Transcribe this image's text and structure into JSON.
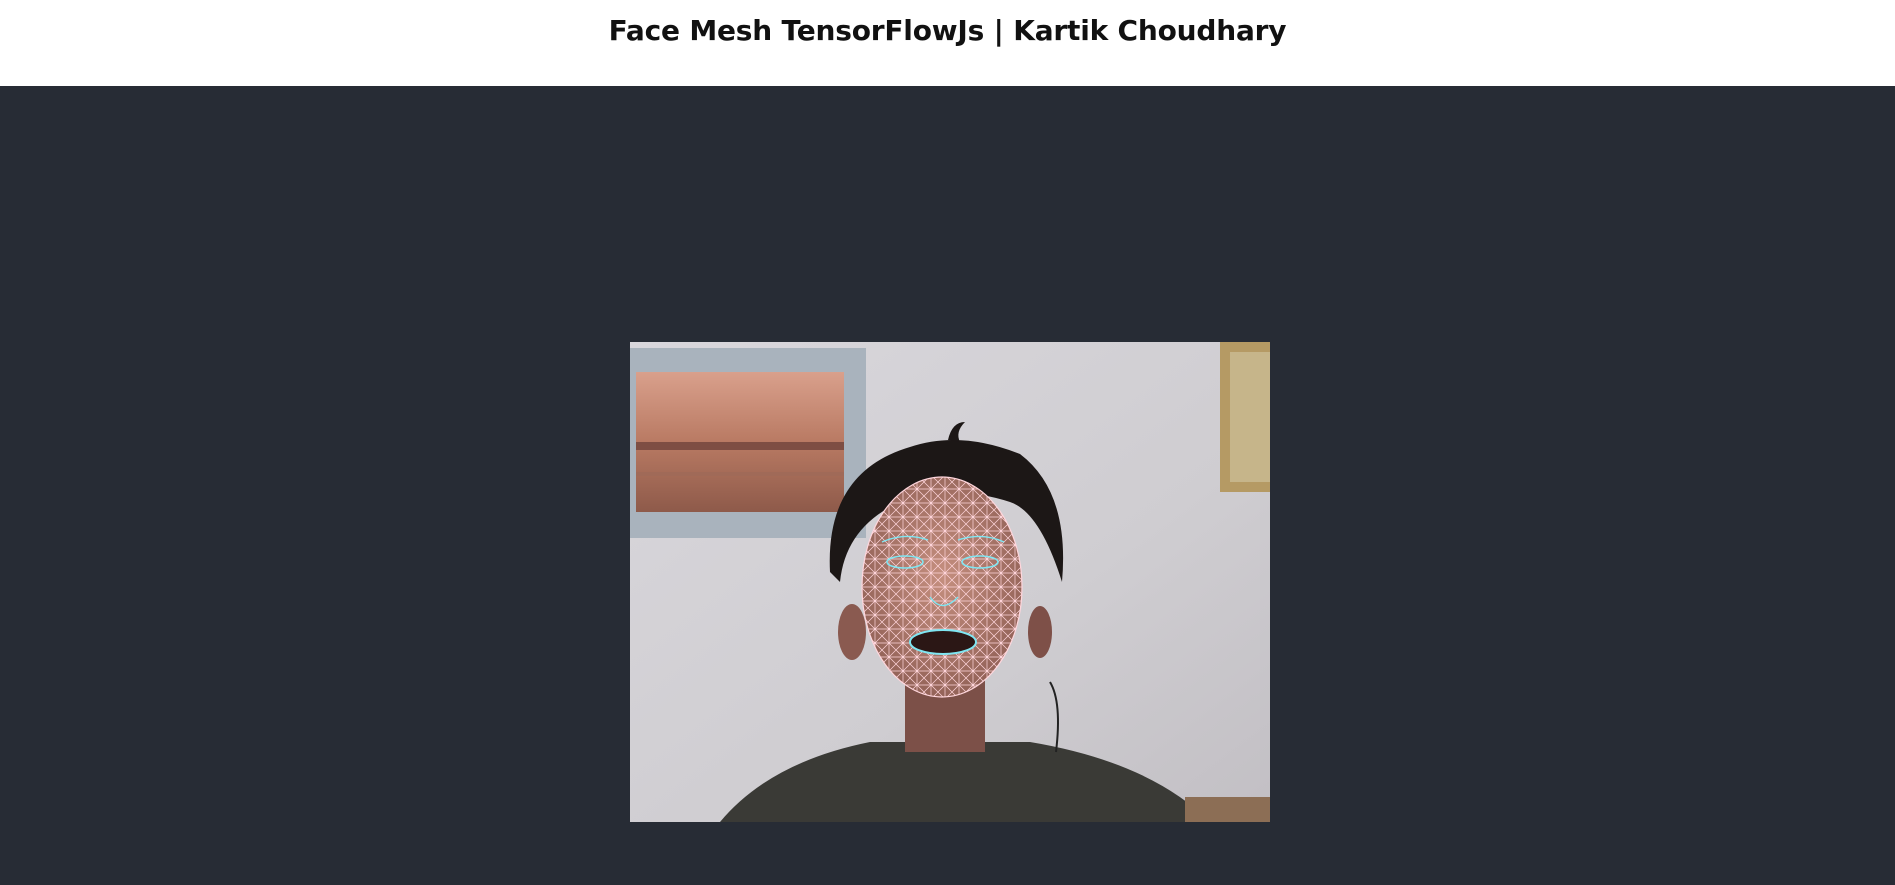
{
  "header": {
    "title": "Face Mesh TensorFlowJs | Kartik Choudhary"
  },
  "colors": {
    "header_bg": "#ffffff",
    "stage_bg": "#272c35",
    "mesh_line": "#ffd6dc",
    "feature_outline": "#7fe6f2"
  },
  "webcam": {
    "subject": "person with face mesh overlay",
    "mesh_overlay": true
  }
}
